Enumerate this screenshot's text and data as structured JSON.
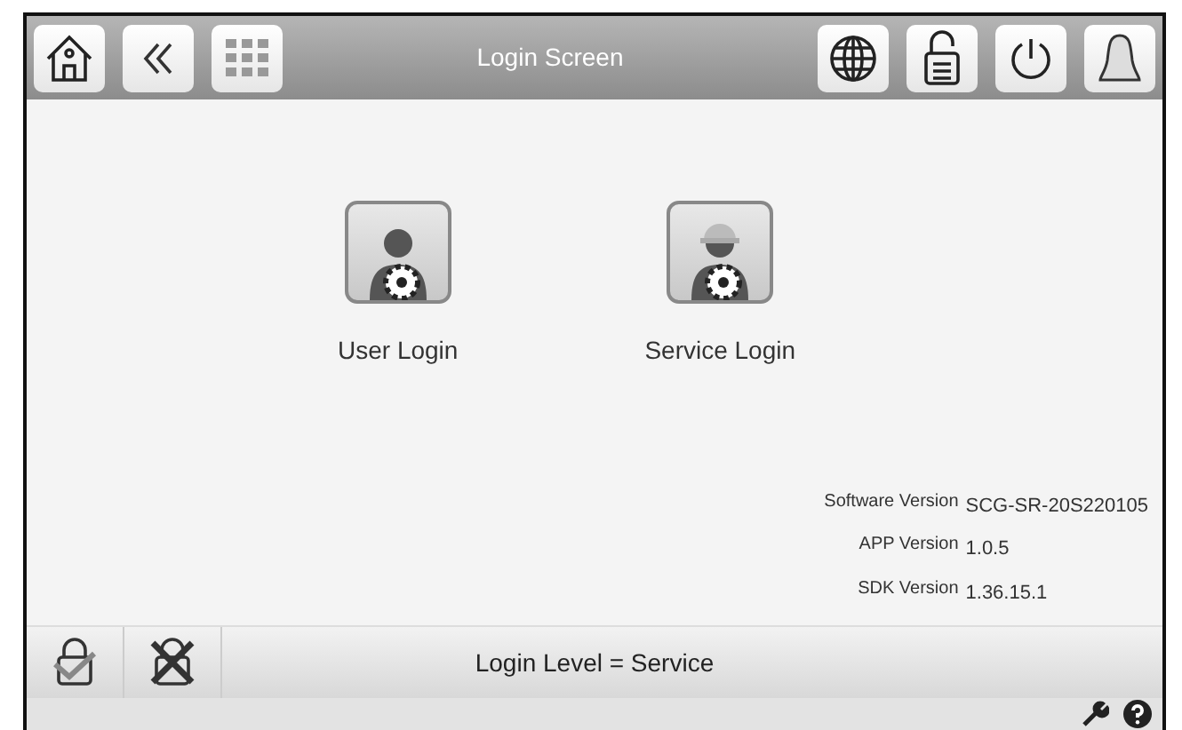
{
  "header": {
    "title": "Login Screen"
  },
  "login_options": [
    {
      "label": "User Login",
      "kind": "user"
    },
    {
      "label": "Service Login",
      "kind": "service"
    }
  ],
  "versions": [
    {
      "label": "Software Version",
      "value": "SCG-SR-20S220105"
    },
    {
      "label": "APP Version",
      "value": "1.0.5"
    },
    {
      "label": "SDK Version",
      "value": "1.36.15.1"
    }
  ],
  "status_bar": {
    "text": "Login Level = Service"
  }
}
